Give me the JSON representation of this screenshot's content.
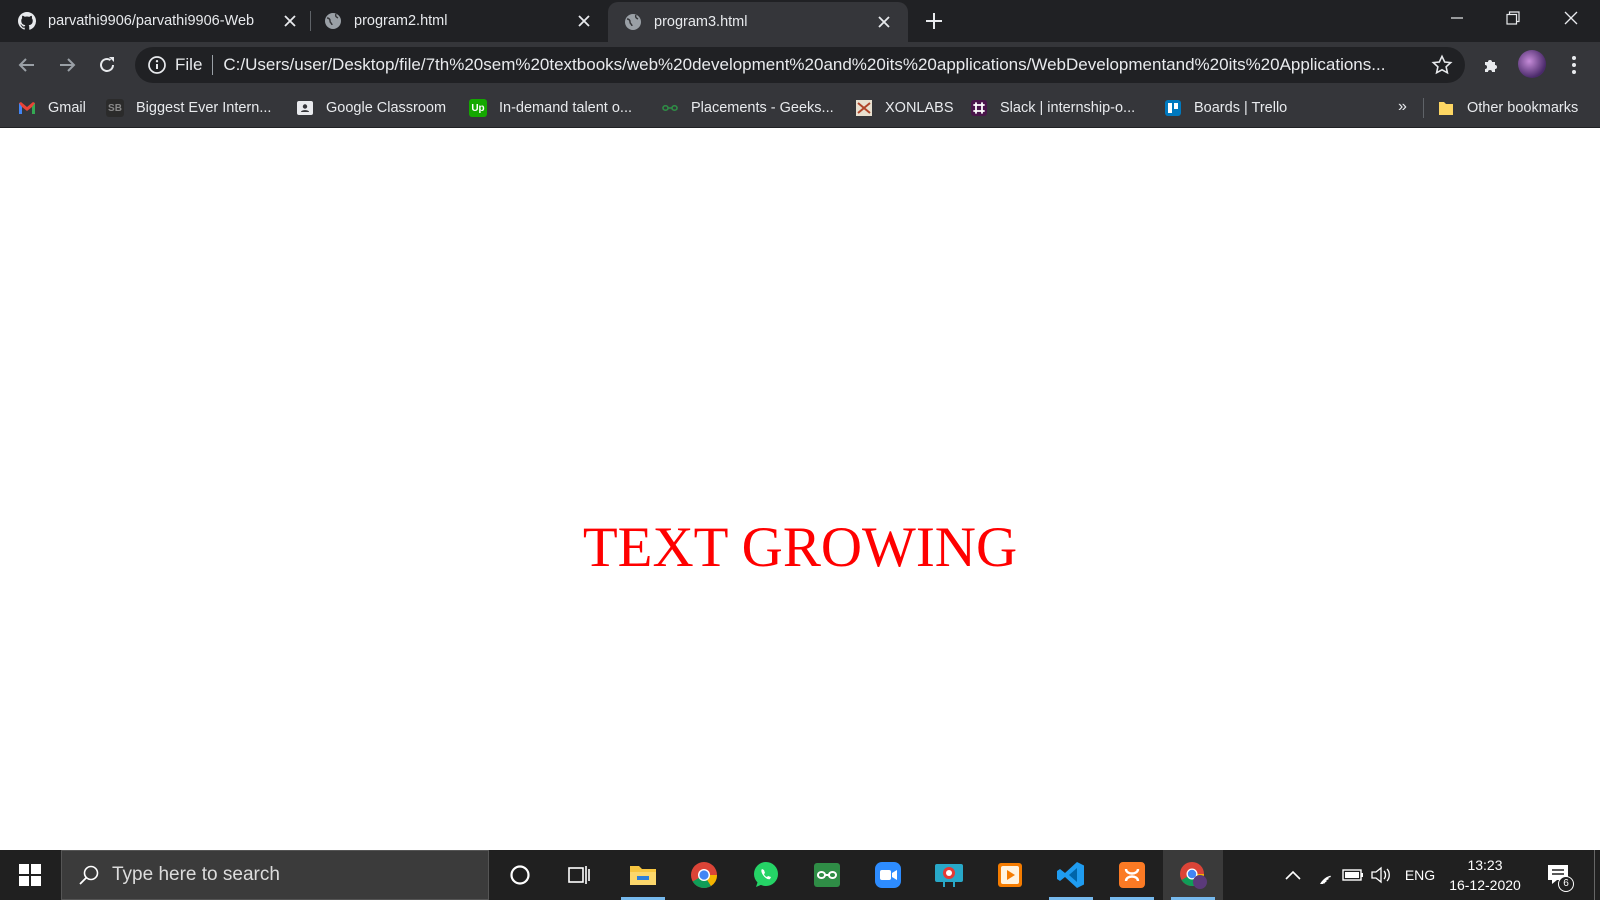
{
  "browser": {
    "tabs": [
      {
        "title": "parvathi9906/parvathi9906-Web",
        "icon": "github-icon",
        "active": false
      },
      {
        "title": "program2.html",
        "icon": "globe-icon",
        "active": false
      },
      {
        "title": "program3.html",
        "icon": "globe-icon",
        "active": true
      }
    ],
    "address_bar": {
      "scheme_label": "File",
      "url": "C:/Users/user/Desktop/file/7th%20sem%20textbooks/web%20development%20and%20its%20applications/WebDevelopmentand%20its%20Applications..."
    },
    "bookmarks": [
      {
        "label": "Gmail",
        "icon": "gmail-icon",
        "color": "#ea4335"
      },
      {
        "label": "Biggest Ever Intern...",
        "icon": "sb-icon",
        "color": "#2b2b2b"
      },
      {
        "label": "Google Classroom",
        "icon": "classroom-icon",
        "color": "#5f6368"
      },
      {
        "label": "In-demand talent o...",
        "icon": "upwork-icon",
        "color": "#14a800"
      },
      {
        "label": "Placements - Geeks...",
        "icon": "geeksforgeeks-icon",
        "color": "#2f8d46"
      },
      {
        "label": "XONLABS",
        "icon": "xonlabs-icon",
        "color": "#d9d9d9"
      },
      {
        "label": "Slack | internship-o...",
        "icon": "slack-icon",
        "color": "#4a154b"
      },
      {
        "label": "Boards | Trello",
        "icon": "trello-icon",
        "color": "#0079bf"
      }
    ],
    "bookmarks_more": "»",
    "other_bookmarks": "Other bookmarks"
  },
  "page": {
    "text": "TEXT GROWING",
    "text_color": "#ff0000"
  },
  "taskbar": {
    "search_placeholder": "Type here to search",
    "apps": [
      {
        "name": "cortana-icon"
      },
      {
        "name": "task-view-icon"
      },
      {
        "name": "file-explorer-icon"
      },
      {
        "name": "chrome-icon"
      },
      {
        "name": "whatsapp-icon"
      },
      {
        "name": "geeksforgeeks-app-icon"
      },
      {
        "name": "zoom-icon"
      },
      {
        "name": "webcam-icon"
      },
      {
        "name": "media-player-icon"
      },
      {
        "name": "vscode-icon"
      },
      {
        "name": "xampp-icon"
      },
      {
        "name": "chrome-profile-icon"
      }
    ],
    "language": "ENG",
    "time": "13:23",
    "date": "16-12-2020",
    "notification_count": "6"
  }
}
